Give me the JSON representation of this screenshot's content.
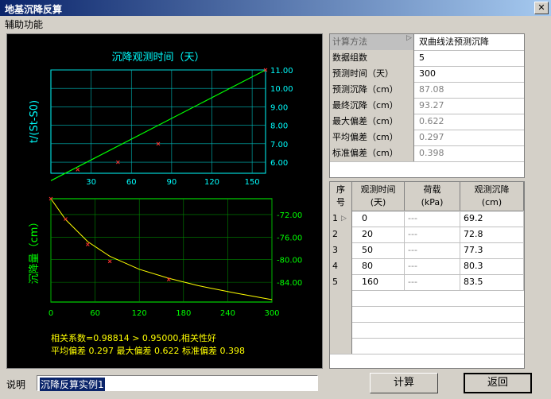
{
  "window": {
    "title": "地基沉降反算"
  },
  "menu": {
    "aux": "辅助功能"
  },
  "params": [
    {
      "label": "计算方法",
      "value": "双曲线法预测沉降"
    },
    {
      "label": "数据组数",
      "value": "5"
    },
    {
      "label": "预测时间（天）",
      "value": "300"
    },
    {
      "label": "预测沉降（cm）",
      "value": "87.08"
    },
    {
      "label": "最终沉降（cm）",
      "value": "93.27"
    },
    {
      "label": "最大偏差（cm）",
      "value": "0.622"
    },
    {
      "label": "平均偏差（cm）",
      "value": "0.297"
    },
    {
      "label": "标准偏差（cm）",
      "value": "0.398"
    }
  ],
  "table": {
    "headers": [
      "序号",
      "观测时间(天)",
      "荷载(kPa)",
      "观测沉降(cm)"
    ],
    "header_lines": [
      [
        "序",
        "号"
      ],
      [
        "观测时间",
        "(天)"
      ],
      [
        "荷载",
        "(kPa)"
      ],
      [
        "观测沉降",
        "(cm)"
      ]
    ],
    "rows": [
      {
        "no": "1",
        "time": "0",
        "load": "---",
        "settle": "69.2"
      },
      {
        "no": "2",
        "time": "20",
        "load": "---",
        "settle": "72.8"
      },
      {
        "no": "3",
        "time": "50",
        "load": "---",
        "settle": "77.3"
      },
      {
        "no": "4",
        "time": "80",
        "load": "---",
        "settle": "80.3"
      },
      {
        "no": "5",
        "time": "160",
        "load": "---",
        "settle": "83.5"
      }
    ]
  },
  "chart_data": [
    {
      "type": "scatter",
      "title": "沉降观测时间（天）",
      "xlabel": "",
      "ylabel": "t/(St-S0)",
      "x_ticks": [
        "30",
        "60",
        "90",
        "120",
        "150"
      ],
      "y_ticks": [
        "6.00",
        "7.00",
        "8.00",
        "9.00",
        "10.00",
        "11.00"
      ],
      "xlim": [
        0,
        160
      ],
      "ylim": [
        5.4,
        11.0
      ],
      "points": [
        [
          20,
          5.6
        ],
        [
          50,
          6.0
        ],
        [
          80,
          7.0
        ],
        [
          160,
          11.0
        ]
      ],
      "fit_line": [
        [
          0,
          5.0
        ],
        [
          160,
          11.0
        ]
      ],
      "colors": {
        "axis": "#00ffff",
        "grid": "#00bbbb",
        "line": "#00ff00",
        "marker": "#ff3030",
        "title": "#00ffff"
      }
    },
    {
      "type": "line",
      "title": "",
      "ylabel": "沉降量（cm）",
      "x_ticks": [
        "0",
        "60",
        "120",
        "180",
        "240",
        "300"
      ],
      "y_ticks": [
        "-72.00",
        "-76.00",
        "-80.00",
        "-84.00"
      ],
      "xlim": [
        0,
        300
      ],
      "ylim": [
        -87.5,
        -69.2
      ],
      "observed": [
        [
          0,
          -69.2
        ],
        [
          20,
          -72.8
        ],
        [
          50,
          -77.3
        ],
        [
          80,
          -80.3
        ],
        [
          160,
          -83.5
        ]
      ],
      "curve": [
        [
          0,
          -69.2
        ],
        [
          20,
          -72.9
        ],
        [
          50,
          -76.8
        ],
        [
          80,
          -79.4
        ],
        [
          120,
          -81.7
        ],
        [
          160,
          -83.3
        ],
        [
          200,
          -84.6
        ],
        [
          250,
          -85.9
        ],
        [
          300,
          -87.08
        ]
      ],
      "colors": {
        "axis": "#00ff00",
        "grid": "#008800",
        "curve": "#ffff00",
        "marker": "#ff3030",
        "ylabel": "#00ff00"
      }
    }
  ],
  "stats": {
    "line1": "相关系数=0.98814 > 0.95000,相关性好",
    "line2": "平均偏差 0.297 最大偏差 0.622 标准偏差 0.398"
  },
  "footer": {
    "label": "说明",
    "input_value": "沉降反算实例1",
    "calc_button": "计算",
    "back_button": "返回"
  }
}
